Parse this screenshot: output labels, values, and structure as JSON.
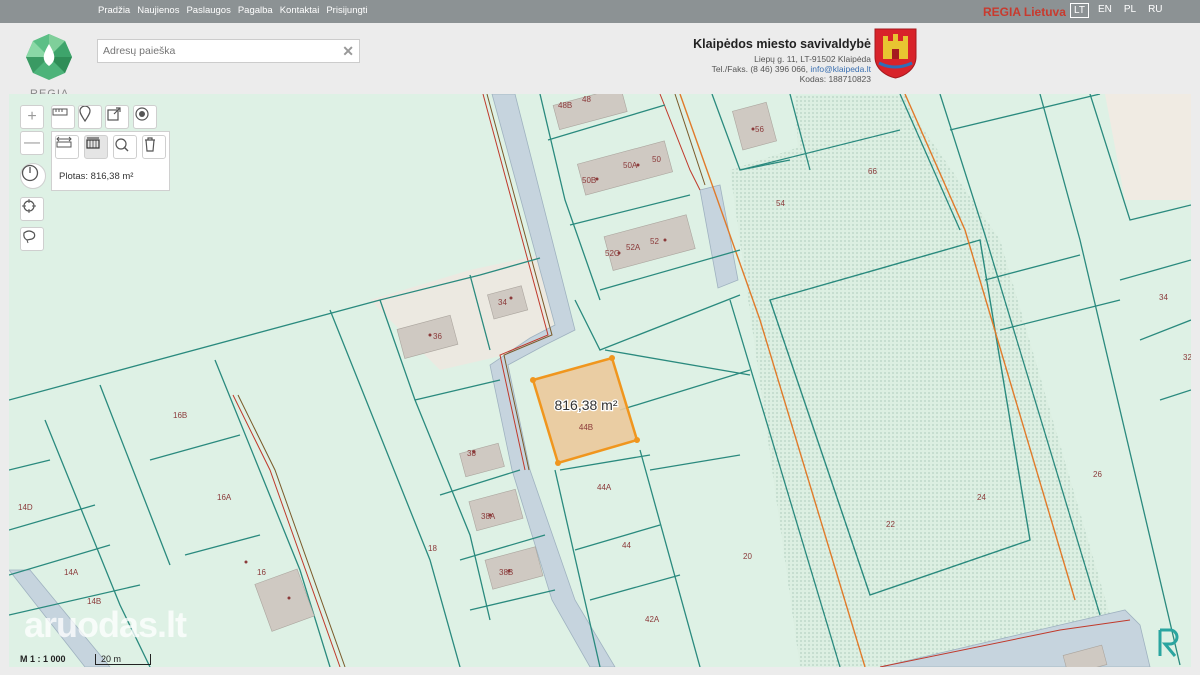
{
  "nav": {
    "items": [
      "Pradžia",
      "Naujienos",
      "Paslaugos",
      "Pagalba",
      "Kontaktai",
      "Prisijungti"
    ]
  },
  "brand": {
    "regia_lietuva": "REGIA Lietuva",
    "logo_text": "REGIA"
  },
  "languages": {
    "items": [
      "LT",
      "EN",
      "PL",
      "RU"
    ],
    "active": "LT"
  },
  "search": {
    "placeholder": "Adresų paieška",
    "value": ""
  },
  "municipality": {
    "name": "Klaipėdos miesto savivaldybė",
    "address": "Liepų g. 11, LT-91502 Klaipėda",
    "phone_prefix": "Tel./Faks. (8 46) 396 066,",
    "email": "info@klaipeda.lt",
    "code": "Kodas: 188710823"
  },
  "map": {
    "measure_panel": {
      "area_text": "Plotas: 816,38 m²"
    },
    "selected_parcel": {
      "area_label": "816,38 m²",
      "number": "44B"
    },
    "scale": {
      "ratio": "M 1 : 1 000",
      "bar_label": "20 m"
    },
    "watermark": "aruodas.lt",
    "parcel_labels": [
      "48B",
      "48",
      "56",
      "66",
      "50A",
      "50",
      "50B",
      "54",
      "52A",
      "52",
      "52C",
      "34",
      "36",
      "34",
      "32",
      "16B",
      "16A",
      "14D",
      "14A",
      "14B",
      "16",
      "18",
      "38",
      "38A",
      "38B",
      "44A",
      "44",
      "42A",
      "20",
      "22",
      "24",
      "26"
    ]
  },
  "colors": {
    "topbar": "#8c9294",
    "brand_red": "#c83a2e",
    "map_bg": "#def1e5",
    "parcel_line": "#2a8a7e",
    "road_fill": "#c6d4de",
    "selected_fill": "#ebc99b",
    "selected_stroke": "#f0961e",
    "orange_line": "#e07a2a"
  },
  "icons": {
    "zoom_in": "plus-icon",
    "zoom_out": "minus-icon",
    "measure": "ruler-icon",
    "marker": "marker-icon",
    "share": "share-icon",
    "target": "target-icon",
    "distance": "distance-icon",
    "area": "area-icon",
    "clear": "refresh-icon",
    "delete": "trash-icon",
    "compass": "compass-icon",
    "locate": "crosshair-icon",
    "lasso": "lasso-icon"
  }
}
